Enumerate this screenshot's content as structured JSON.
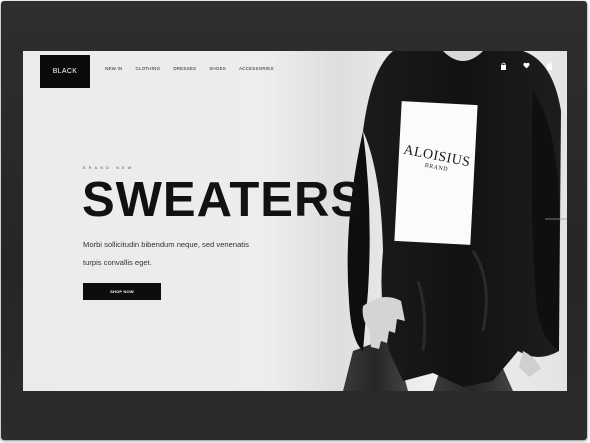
{
  "brand": {
    "logo": "BLACK"
  },
  "nav": {
    "items": [
      "NEW IN",
      "CLOTHING",
      "DRESSES",
      "SHOES",
      "ACCESSORIES"
    ]
  },
  "header_icons": [
    "shopping-bag-icon",
    "heart-icon",
    "cart-icon"
  ],
  "hero": {
    "eyebrow": "BRAND NEW",
    "headline": "SWEATERS",
    "description_line1": "Morbi sollicitudin bibendum neque, sed venenatis",
    "description_line2": "turpis convallis eget.",
    "cta": "SHOP NOW"
  },
  "product": {
    "tag_line1": "ALOISIUS",
    "tag_line2": "BRAND"
  },
  "colors": {
    "frame": "#2b2b2b",
    "screen_bg": "#ececec",
    "accent": "#0b0b0b"
  }
}
